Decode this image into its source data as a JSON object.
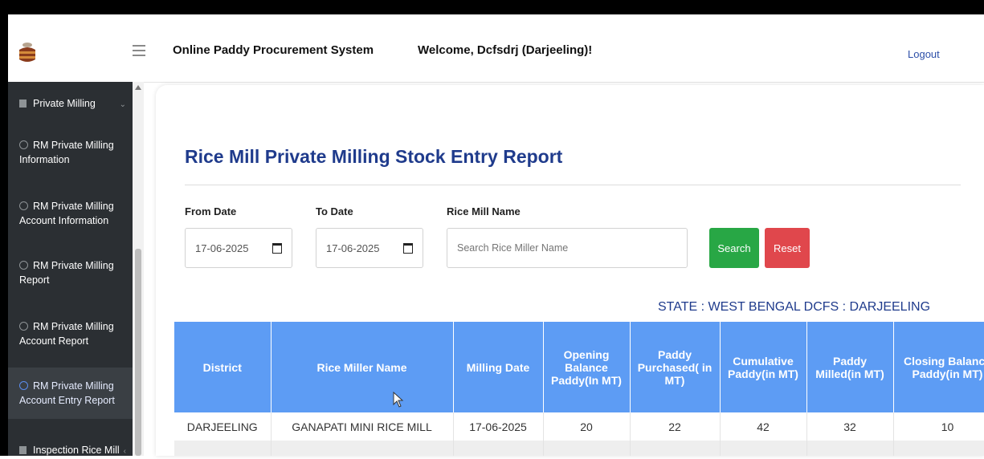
{
  "header": {
    "app_title": "Online Paddy Procurement System",
    "welcome": "Welcome, Dcfsdrj (Darjeeling)!",
    "logout": "Logout"
  },
  "sidebar": {
    "items": [
      {
        "label_lines": [
          "Private Milling"
        ]
      },
      {
        "label_lines": [
          "RM Private Milling",
          "Information"
        ]
      },
      {
        "label_lines": [
          "RM Private Milling",
          "Account Information"
        ]
      },
      {
        "label_lines": [
          "RM Private Milling",
          "Report"
        ]
      },
      {
        "label_lines": [
          "RM Private Milling",
          "Account Report"
        ]
      },
      {
        "label_lines": [
          "RM Private Milling",
          "Account Entry Report"
        ]
      },
      {
        "label_lines": [
          "Inspection Rice Mill"
        ]
      }
    ]
  },
  "page": {
    "title": "Rice Mill Private Milling Stock Entry Report",
    "from_label": "From Date",
    "to_label": "To Date",
    "mill_label": "Rice Mill Name",
    "from_value": "17-06-2025",
    "to_value": "17-06-2025",
    "search_placeholder": "Search Rice Miller Name",
    "search_btn": "Search",
    "reset_btn": "Reset",
    "state_line": "STATE : WEST BENGAL DCFS : DARJEELING"
  },
  "table": {
    "headers": [
      "District",
      "Rice Miller Name",
      "Milling Date",
      "Opening Balance Paddy(In MT)",
      "Paddy Purchased( in MT)",
      "Cumulative Paddy(in MT)",
      "Paddy Milled(in MT)",
      "Closing Balance Paddy(in MT)"
    ],
    "rows": [
      [
        "DARJEELING",
        "GANAPATI MINI RICE MILL",
        "17-06-2025",
        "20",
        "22",
        "42",
        "32",
        "10"
      ]
    ]
  },
  "colors": {
    "sidebar_bg": "#2b2f33",
    "table_header": "#5d9cf4",
    "title_blue": "#1f3b8c",
    "search_green": "#28a745",
    "reset_red": "#e0474c"
  }
}
